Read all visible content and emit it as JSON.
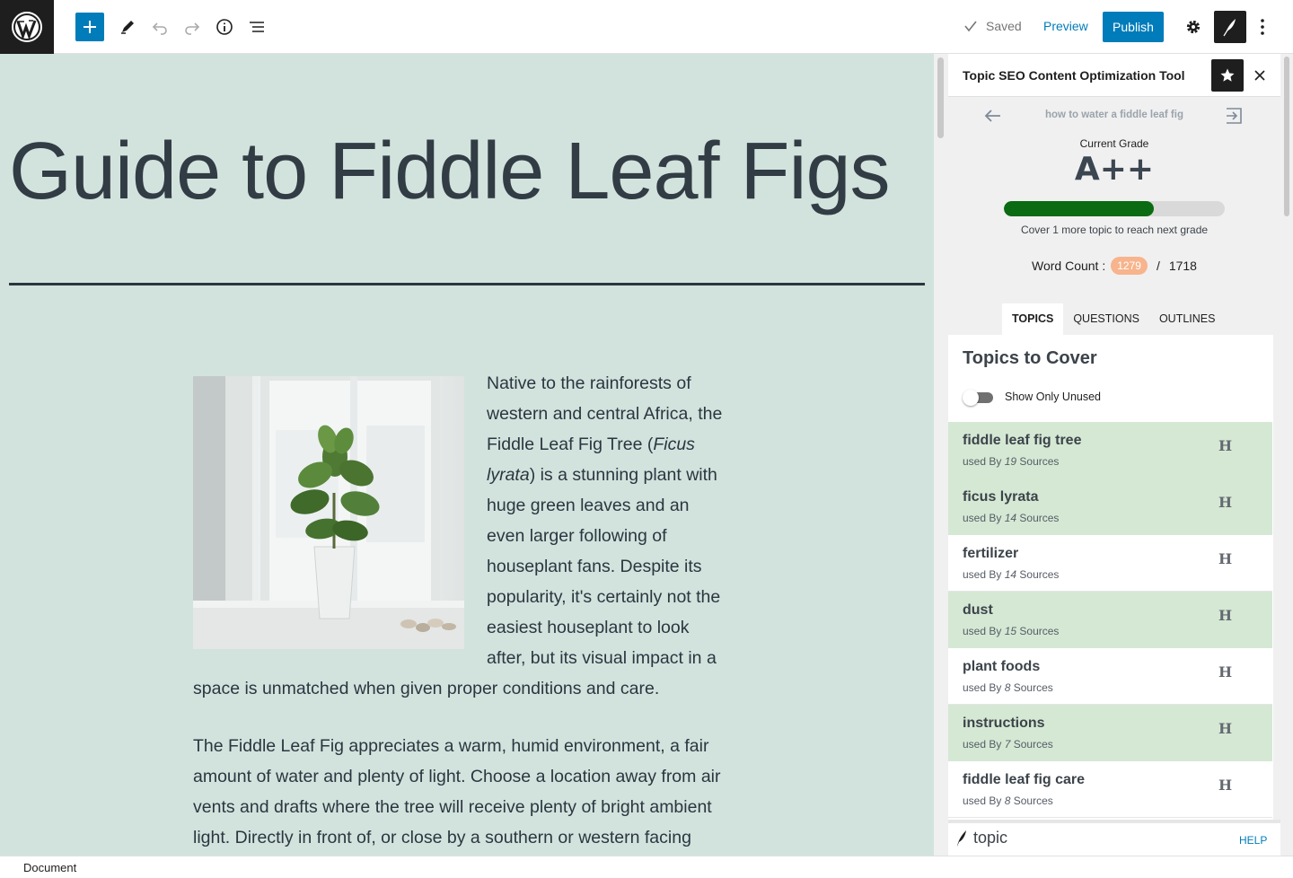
{
  "toolbar": {
    "saved_label": "Saved",
    "preview_label": "Preview",
    "publish_label": "Publish"
  },
  "post": {
    "title": "Guide to Fiddle Leaf Figs",
    "paragraph1_a": "Native to the rainforests of western and central Africa, the Fiddle Leaf Fig Tree (",
    "paragraph1_italic": "Ficus lyrata",
    "paragraph1_b": ") is a stunning plant with huge green leaves and an even larger following of houseplant fans. Despite its popularity, it's certainly not the easiest houseplant to look after, but its visual impact in a space is unmatched when given proper conditions and care.",
    "paragraph2": "The Fiddle Leaf Fig appreciates a warm, humid environment, a fair amount of water and plenty of light. Choose a location away from air vents and drafts where the tree will receive plenty of bright ambient light. Directly in front of, or close by a southern or western facing"
  },
  "sidebar": {
    "title": "Topic SEO Content Optimization Tool",
    "keyword": "how to water a fiddle leaf fig",
    "grade_label": "Current Grade",
    "grade": "A++",
    "grade_progress": 0.68,
    "grade_hint": "Cover 1 more topic to reach next grade",
    "word_count_label": "Word Count :",
    "word_count": "1279",
    "word_count_sep": "/",
    "word_count_target": "1718",
    "tabs": [
      "TOPICS",
      "QUESTIONS",
      "OUTLINES"
    ],
    "panel_title": "Topics to Cover",
    "toggle_label": "Show Only Unused",
    "used_by_prefix": "used By",
    "sources_suffix": "Sources",
    "heading_marker": "H",
    "topics": [
      {
        "name": "fiddle leaf fig tree",
        "count": "19",
        "used": true
      },
      {
        "name": "ficus lyrata",
        "count": "14",
        "used": true
      },
      {
        "name": "fertilizer",
        "count": "14",
        "used": false
      },
      {
        "name": "dust",
        "count": "15",
        "used": true
      },
      {
        "name": "plant foods",
        "count": "8",
        "used": false
      },
      {
        "name": "instructions",
        "count": "7",
        "used": true
      },
      {
        "name": "fiddle leaf fig care",
        "count": "8",
        "used": false
      }
    ],
    "brand": "topic",
    "help_label": "HELP"
  },
  "footer": {
    "breadcrumb": "Document"
  },
  "colors": {
    "accent": "#007cba",
    "canvas_bg": "#d2e3dd",
    "used_topic_bg": "#d5e8d4",
    "progress_fill": "#0a6b12",
    "word_count_badge": "#f7b48d"
  }
}
